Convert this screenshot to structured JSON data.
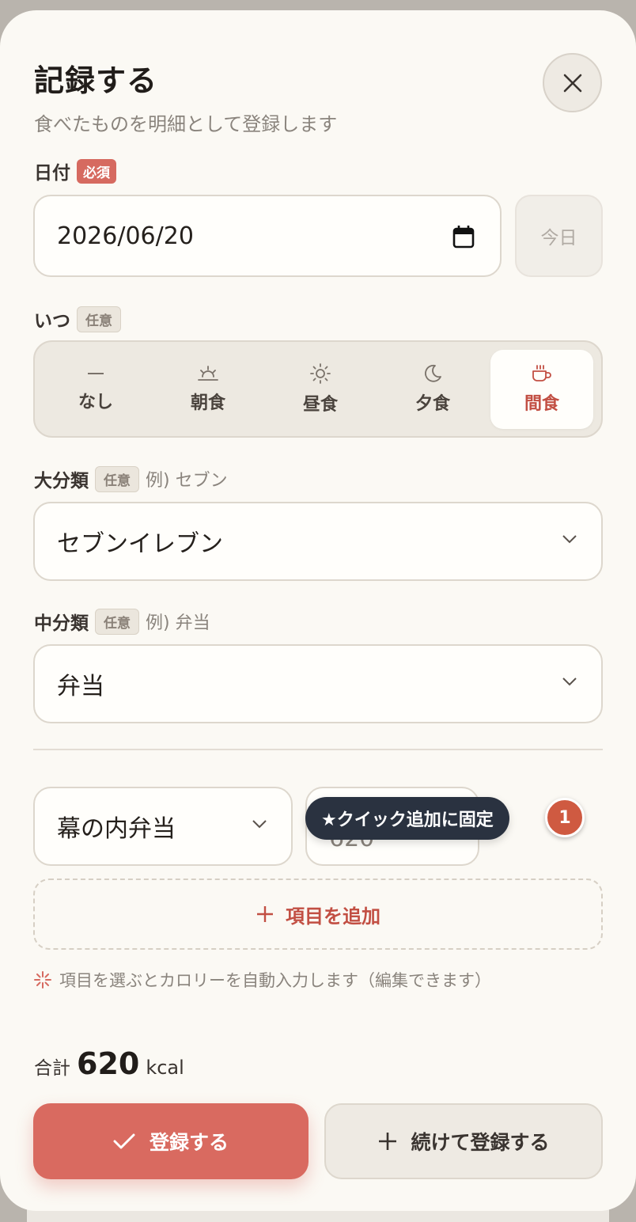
{
  "header": {
    "title": "記録する",
    "subtitle": "食べたものを明細として登録します"
  },
  "date": {
    "label": "日付",
    "badge": "必須",
    "value": "2026/06/20",
    "today_label": "今日"
  },
  "when": {
    "label": "いつ",
    "badge": "任意",
    "options": [
      {
        "label": "なし",
        "icon": "dash-icon"
      },
      {
        "label": "朝食",
        "icon": "sunrise-icon"
      },
      {
        "label": "昼食",
        "icon": "sun-icon"
      },
      {
        "label": "夕食",
        "icon": "moon-icon"
      },
      {
        "label": "間食",
        "icon": "cup-icon"
      }
    ],
    "selected": "間食"
  },
  "major_category": {
    "label": "大分類",
    "badge": "任意",
    "hint": "例) セブン",
    "value": "セブンイレブン"
  },
  "mid_category": {
    "label": "中分類",
    "badge": "任意",
    "hint": "例) 弁当",
    "value": "弁当"
  },
  "item": {
    "name": "幕の内弁当",
    "calories": "620"
  },
  "tooltip": "★クイック追加に固定",
  "step_badge": "1",
  "add_item_label": "項目を追加",
  "note": "項目を選ぶとカロリーを自動入力します（編集できます）",
  "total": {
    "label": "合計",
    "value": "620",
    "unit": "kcal"
  },
  "buttons": {
    "submit": "登録する",
    "submit_continue": "続けて登録する"
  },
  "colors": {
    "accent": "#d96a60",
    "accent_text": "#c24f43",
    "sheet_bg": "#fbf9f4",
    "tooltip_bg": "#2a3240"
  }
}
